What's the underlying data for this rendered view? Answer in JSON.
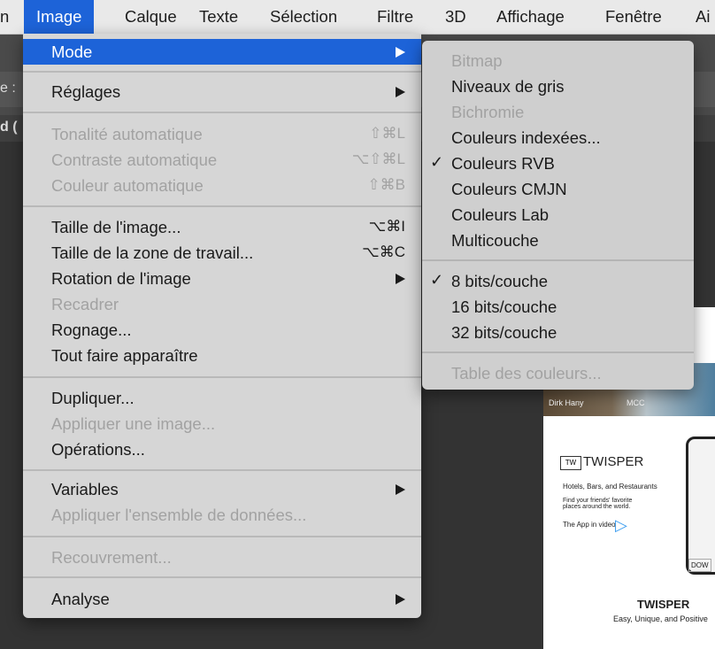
{
  "menubar": {
    "items": [
      "n",
      "Image",
      "Calque",
      "Texte",
      "Sélection",
      "Filtre",
      "3D",
      "Affichage",
      "Fenêtre",
      "Ai"
    ]
  },
  "toolbar": {
    "left1": "e :",
    "left2": "d ("
  },
  "image_menu": {
    "items": [
      {
        "label": "Mode",
        "state": "highlighted",
        "submenu": true
      },
      {
        "label": "Réglages",
        "submenu": true
      },
      {
        "label": "Tonalité automatique",
        "shortcut": "⇧⌘L",
        "disabled": true
      },
      {
        "label": "Contraste automatique",
        "shortcut": "⌥⇧⌘L",
        "disabled": true
      },
      {
        "label": "Couleur automatique",
        "shortcut": "⇧⌘B",
        "disabled": true
      },
      {
        "label": "Taille de l'image...",
        "shortcut": "⌥⌘I"
      },
      {
        "label": "Taille de la zone de travail...",
        "shortcut": "⌥⌘C"
      },
      {
        "label": "Rotation de l'image",
        "submenu": true
      },
      {
        "label": "Recadrer",
        "disabled": true
      },
      {
        "label": "Rognage..."
      },
      {
        "label": "Tout faire apparaître"
      },
      {
        "label": "Dupliquer..."
      },
      {
        "label": "Appliquer une image...",
        "disabled": true
      },
      {
        "label": "Opérations..."
      },
      {
        "label": "Variables",
        "submenu": true
      },
      {
        "label": "Appliquer l'ensemble de données...",
        "disabled": true
      },
      {
        "label": "Recouvrement...",
        "disabled": true
      },
      {
        "label": "Analyse",
        "submenu": true
      }
    ]
  },
  "mode_submenu": {
    "items": [
      {
        "label": "Bitmap",
        "disabled": true
      },
      {
        "label": "Niveaux de gris"
      },
      {
        "label": "Bichromie",
        "disabled": true
      },
      {
        "label": "Couleurs indexées..."
      },
      {
        "label": "Couleurs RVB",
        "checked": true
      },
      {
        "label": "Couleurs CMJN"
      },
      {
        "label": "Couleurs Lab"
      },
      {
        "label": "Multicouche"
      },
      {
        "label": "8 bits/couche",
        "checked": true
      },
      {
        "label": "16 bits/couche"
      },
      {
        "label": "32 bits/couche"
      },
      {
        "label": "Table des couleurs...",
        "disabled": true
      }
    ],
    "check_glyph": "✓"
  },
  "document": {
    "photo_label_1": "Dirk Hany",
    "photo_label_2": "MCC",
    "brand_small": "TWISPER",
    "tagline_1": "Hotels, Bars, and Restaurants",
    "tagline_2": "Find your friends' favorite places around the world.",
    "tagline_3": "The App in video",
    "brand_large": "TWISPER",
    "slogan": "Easy, Unique, and Positive",
    "download": "DOW"
  },
  "colors": {
    "accent": "#1d63d8",
    "menu_bg": "#d6d6d6",
    "disabled_text": "#a2a2a2"
  }
}
